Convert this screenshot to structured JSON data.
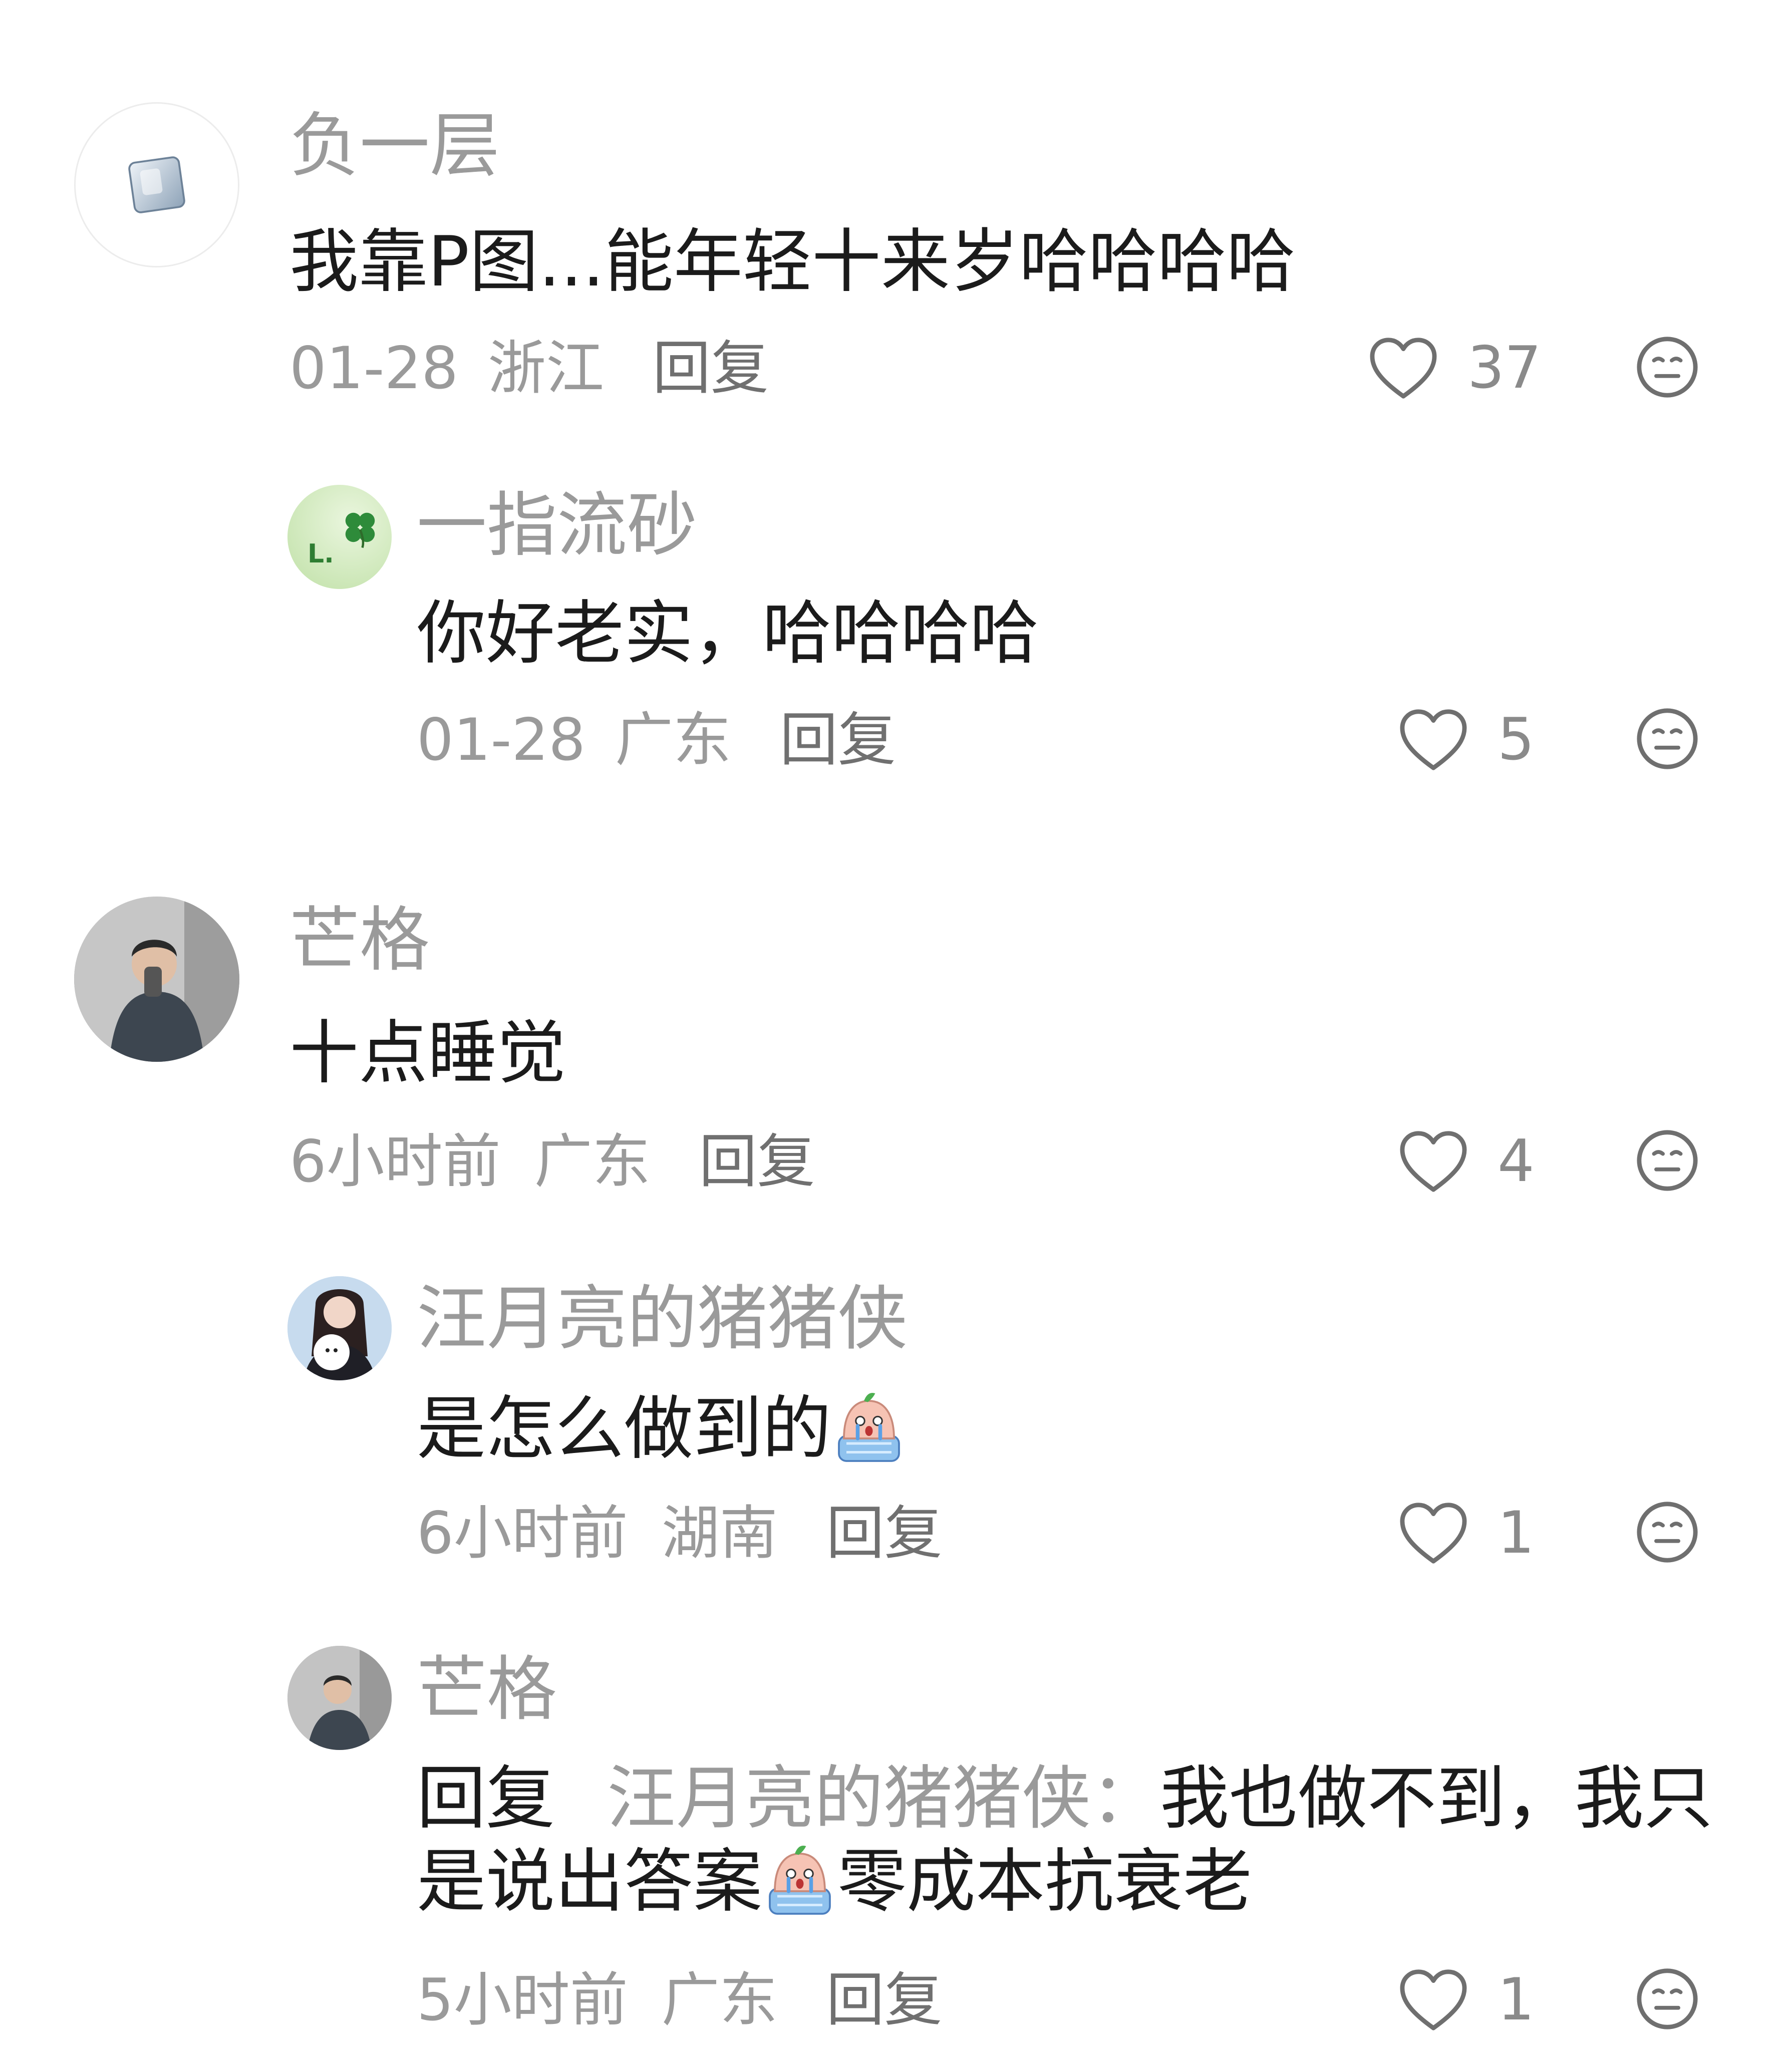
{
  "comments": [
    {
      "username": "负一层",
      "text": "我靠P图...能年轻十来岁哈哈哈哈",
      "time": "01-28",
      "location": "浙江",
      "reply_label": "回复",
      "likes": "37",
      "replies": [
        {
          "username": "一指流砂",
          "text": "你好老实，哈哈哈哈",
          "time": "01-28",
          "location": "广东",
          "reply_label": "回复",
          "likes": "5",
          "avatar_text": "L."
        }
      ]
    },
    {
      "username": "芒格",
      "text": "十点睡觉",
      "time": "6小时前",
      "location": "广东",
      "reply_label": "回复",
      "likes": "4",
      "replies": [
        {
          "username": "汪月亮的猪猪侠",
          "text": "是怎么做到的",
          "time": "6小时前",
          "location": "湖南",
          "reply_label": "回复",
          "likes": "1"
        },
        {
          "username": "芒格",
          "reply_prefix": "回复",
          "reply_to": "汪月亮的猪猪侠",
          "colon": "：",
          "text_part1": "我也做不到，我只是说出答案",
          "text_part2": "零成本抗衰老",
          "time": "5小时前",
          "location": "广东",
          "reply_label": "回复",
          "likes": "1"
        }
      ]
    }
  ],
  "icons": {
    "like": "heart-outline-icon",
    "dislike": "neutral-face-icon",
    "emoji": "crying-sticker-emoji"
  },
  "colors": {
    "username": "#9a9a9a",
    "text": "#1b1b1b",
    "meta": "#9a9a9a",
    "icon": "#6f6f6f"
  }
}
